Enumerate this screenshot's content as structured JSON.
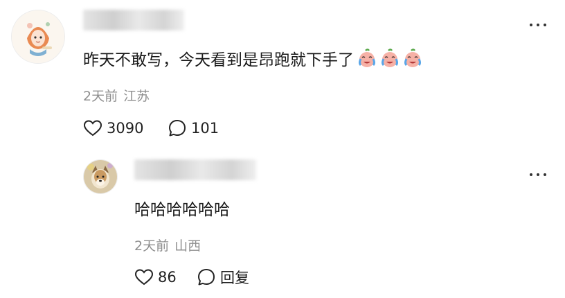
{
  "comment": {
    "text": "昨天不敢写，今天看到是昂跑就下手了",
    "emoji_name": "crying-face-emoji",
    "emoji_count": 3,
    "time": "2天前",
    "location": "江苏",
    "likes": "3090",
    "replies": "101"
  },
  "reply": {
    "text": "哈哈哈哈哈哈",
    "time": "2天前",
    "location": "山西",
    "likes": "86",
    "reply_label": "回复"
  },
  "icons": {
    "like": "heart-outline-icon",
    "comment": "speech-bubble-icon",
    "more": "more-dots-icon"
  }
}
